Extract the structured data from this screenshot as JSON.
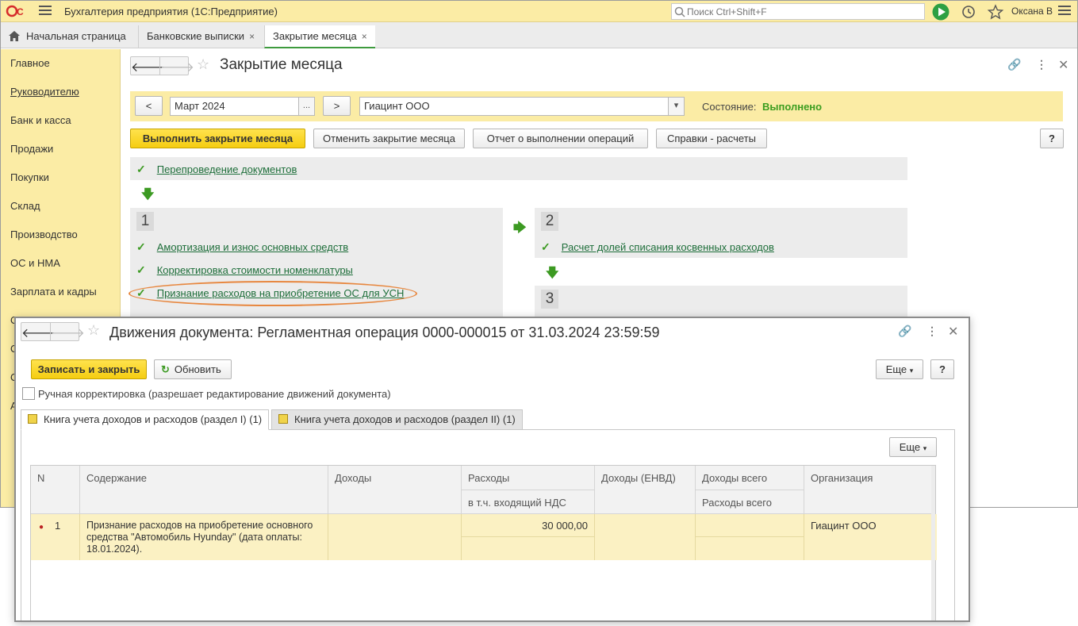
{
  "app": {
    "title": "Бухгалтерия предприятия  (1С:Предприятие)",
    "search_placeholder": "Поиск Ctrl+Shift+F",
    "user": "Оксана В",
    "logo_text": "1С"
  },
  "tabs": [
    {
      "label": "Начальная страница"
    },
    {
      "label": "Банковские выписки",
      "close": "×"
    },
    {
      "label": "Закрытие месяца",
      "close": "×"
    }
  ],
  "sidebar": {
    "items": [
      "Главное",
      "Руководителю",
      "Банк и касса",
      "Продажи",
      "Покупки",
      "Склад",
      "Производство",
      "ОС и НМА",
      "Зарплата и кадры"
    ],
    "partial_items": [
      "О",
      "О",
      "О",
      "А"
    ]
  },
  "form": {
    "title": "Закрытие месяца",
    "prev": "<",
    "next": ">",
    "period": "Март 2024",
    "period_btn": "...",
    "org": "Гиацинт ООО",
    "state_label": "Состояние:",
    "state_value": "Выполнено",
    "buttons": {
      "run": "Выполнить закрытие месяца",
      "cancel": "Отменить закрытие месяца",
      "report": "Отчет о выполнении операций",
      "calc": "Справки - расчеты",
      "help": "?"
    },
    "repost": "Перепроведение документов",
    "step1": {
      "num": "1",
      "ops": [
        "Амортизация и износ основных средств",
        "Корректировка стоимости номенклатуры",
        "Признание расходов на приобретение ОС для УСН"
      ]
    },
    "step2": {
      "num": "2",
      "ops": [
        "Расчет долей списания косвенных расходов"
      ]
    },
    "step3": {
      "num": "3"
    }
  },
  "dialog": {
    "title": "Движения документа: Регламентная операция 0000-000015 от 31.03.2024 23:59:59",
    "save_close": "Записать и закрыть",
    "refresh": "Обновить",
    "more": "Еще",
    "help": "?",
    "manual_label": "Ручная корректировка (разрешает редактирование движений документа)",
    "tabs": [
      "Книга учета доходов и расходов (раздел I) (1)",
      "Книга учета доходов и расходов (раздел II) (1)"
    ],
    "grid_more": "Еще",
    "columns": {
      "n": "N",
      "content": "Содержание",
      "income": "Доходы",
      "expenses": "Расходы",
      "expenses_vat": "в т.ч. входящий НДС",
      "income_envd": "Доходы (ЕНВД)",
      "income_total": "Доходы всего",
      "expenses_total": "Расходы всего",
      "org": "Организация"
    },
    "rows": [
      {
        "n": "1",
        "content": "Признание расходов на приобретение основного средства \"Автомобиль Hyunday\" (дата оплаты: 18.01.2024).",
        "income": "",
        "expenses": "30 000,00",
        "org": "Гиацинт ООО"
      }
    ]
  },
  "colors": {
    "accent_yellow": "#fbeca5",
    "button_yellow": "#f5cd11",
    "success_green": "#3b9d1f",
    "link_green": "#1e6e3a",
    "highlight_orange": "#e7873f"
  }
}
